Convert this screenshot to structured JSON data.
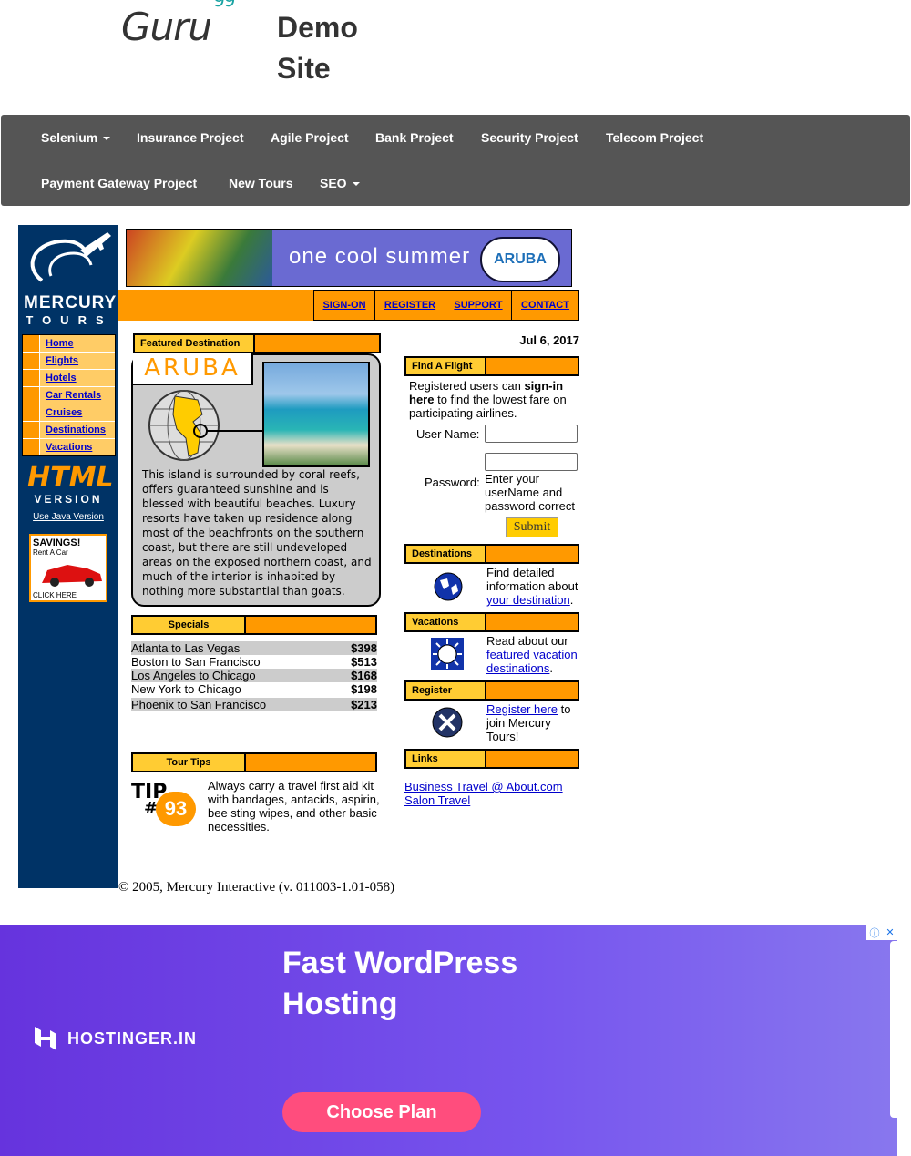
{
  "header": {
    "logo_text": "Guru",
    "logo_sup": "99",
    "site_title": "Demo Site"
  },
  "nav": {
    "row1": [
      "Selenium",
      "Insurance Project",
      "Agile Project",
      "Bank Project",
      "Security Project",
      "Telecom Project"
    ],
    "row2": [
      "Payment Gateway Project",
      "New Tours",
      "SEO"
    ]
  },
  "mercury": {
    "logo_line1": "MERCURY",
    "logo_line2": "TOURS",
    "banner_text": "one cool summer",
    "banner_badge": "ARUBA",
    "top_links": [
      "SIGN-ON",
      "REGISTER",
      "SUPPORT",
      "CONTACT"
    ],
    "menu": [
      "Home",
      "Flights",
      "Hotels",
      "Car Rentals",
      "Cruises",
      "Destinations",
      "Vacations"
    ],
    "html_version_big": "HTML",
    "html_version_small": "VERSION",
    "java_link": "Use Java Version",
    "savings_title": "SAVINGS!",
    "savings_sub": "Rent A Car",
    "savings_click": "CLICK HERE",
    "featured": {
      "header": "Featured Destination",
      "title": "ARUBA",
      "text": "This island is surrounded by coral reefs, offers guaranteed sunshine and is blessed with beautiful beaches. Luxury resorts have taken up residence along most of the beachfronts on the southern coast, but there are still undeveloped areas on the exposed northern coast, and much of the interior is inhabited by nothing more substantial than goats."
    },
    "specials": {
      "header": "Specials",
      "rows": [
        {
          "route": "Atlanta to Las Vegas",
          "price": "$398"
        },
        {
          "route": "Boston to San Francisco",
          "price": "$513"
        },
        {
          "route": "Los Angeles to Chicago",
          "price": "$168"
        },
        {
          "route": "New York to Chicago",
          "price": "$198"
        },
        {
          "route": "Phoenix to San Francisco",
          "price": "$213"
        }
      ]
    },
    "tour_tips": {
      "header": "Tour Tips",
      "tip_word": "TIP",
      "tip_hash": "#",
      "tip_number": "93",
      "text": "Always carry a travel first aid kit with bandages, antacids, aspirin, bee sting wipes, and other basic necessities."
    },
    "date": "Jul 6, 2017",
    "find_flight": {
      "header": "Find A Flight",
      "intro_pre": "Registered users can ",
      "intro_bold": "sign-in here",
      "intro_post": " to find the lowest fare on participating airlines.",
      "username_label": "User Name:",
      "password_label": "Password:",
      "password_hint": "Enter your userName and password correct",
      "submit": "Submit"
    },
    "destinations": {
      "header": "Destinations",
      "text": "Find detailed information about ",
      "link": "your destination",
      "suffix": "."
    },
    "vacations": {
      "header": "Vacations",
      "text": "Read about our ",
      "link": "featured vacation destinations",
      "suffix": "."
    },
    "register": {
      "header": "Register",
      "link": "Register here",
      "text": " to join Mercury Tours!"
    },
    "links": {
      "header": "Links",
      "items": [
        "Business Travel @ About.com",
        "Salon Travel"
      ]
    },
    "copyright": "© 2005, Mercury Interactive (v. 011003-1.01-058)"
  },
  "ad": {
    "brand": "HOSTINGER.IN",
    "headline": "Fast WordPress Hosting",
    "cta": "Choose Plan",
    "info_icon": "ⓘ",
    "close_icon": "✕",
    "colors": {
      "bg_start": "#6633dd",
      "cta": "#ff4d7d"
    }
  },
  "colors": {
    "navbar": "#555555",
    "mercury_blue": "#003366",
    "mercury_orange": "#ff9900",
    "header_yellow": "#ffcc33"
  }
}
